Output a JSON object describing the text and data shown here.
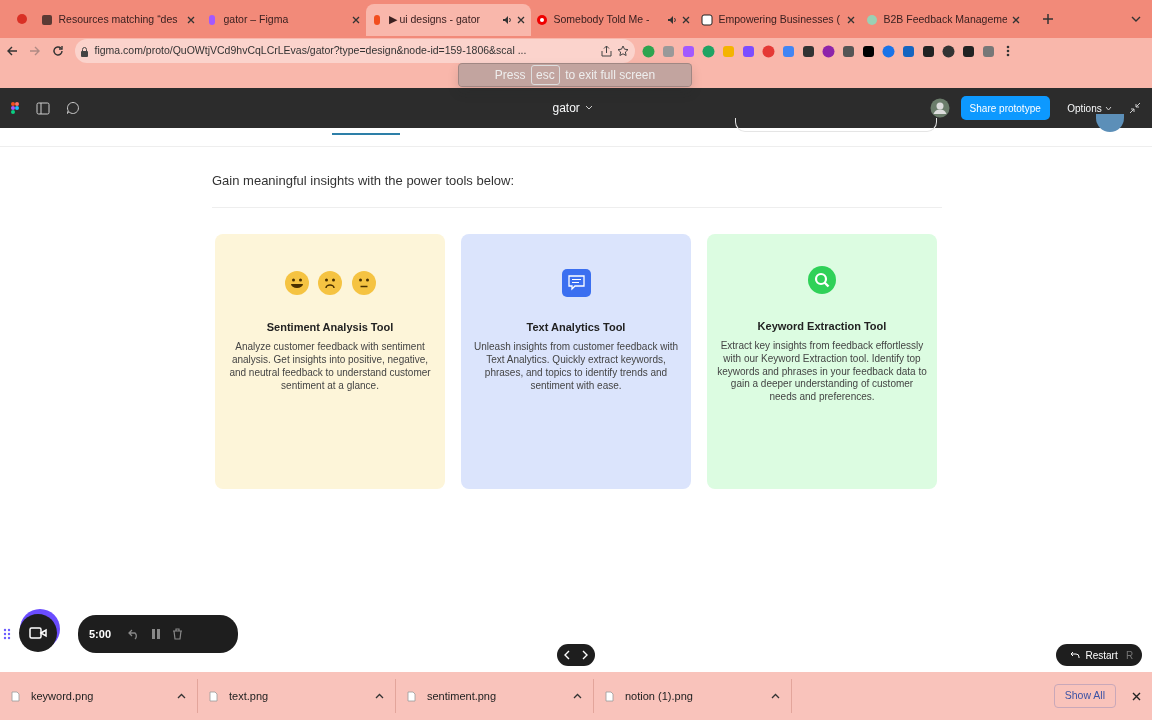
{
  "browser": {
    "tabs": [
      {
        "title": "Resources matching “des",
        "selected": false,
        "audio": false
      },
      {
        "title": "gator – Figma",
        "selected": false,
        "audio": false
      },
      {
        "title": "▶ ui designs - gator",
        "selected": true,
        "audio": true
      },
      {
        "title": "Somebody Told Me -",
        "selected": false,
        "audio": true
      },
      {
        "title": "Empowering Businesses (",
        "selected": false,
        "audio": false
      },
      {
        "title": "B2B Feedback Manageme",
        "selected": false,
        "audio": false
      }
    ],
    "url": "figma.com/proto/QuOWtjVCd9hvCqLCrLEvas/gator?type=design&node-id=159-1806&scal ..."
  },
  "fullscreen_toast": {
    "prefix": "Press",
    "key": "esc",
    "suffix": "to exit full screen"
  },
  "figma_bar": {
    "file": "gator",
    "share": "Share prototype",
    "options": "Options"
  },
  "page": {
    "heading": "Gain meaningful insights with the power tools below:",
    "tools": [
      {
        "kind": "sentiment",
        "title": "Sentiment Analysis Tool",
        "description": "Analyze customer feedback with sentiment analysis. Get insights into positive, negative, and neutral feedback to understand customer sentiment at a glance.",
        "color": "#fdf5d9"
      },
      {
        "kind": "text",
        "title": "Text Analytics Tool",
        "description": "Unleash insights from customer feedback with Text Analytics. Quickly extract keywords, phrases, and topics to identify trends and sentiment with ease.",
        "color": "#dbe4fc"
      },
      {
        "kind": "keyword",
        "title": "Keyword Extraction Tool",
        "description": "Extract key insights from feedback effortlessly with our Keyword Extraction tool. Identify top keywords and phrases in your feedback data to gain a deeper understanding of customer needs and preferences.",
        "color": "#dcfce1"
      }
    ]
  },
  "recorder": {
    "time": "5:00"
  },
  "restart": {
    "label": "Restart",
    "key": "R"
  },
  "downloads": {
    "files": [
      {
        "name": "keyword.png"
      },
      {
        "name": "text.png"
      },
      {
        "name": "sentiment.png"
      },
      {
        "name": "notion (1).png"
      }
    ],
    "show_all": "Show All"
  }
}
